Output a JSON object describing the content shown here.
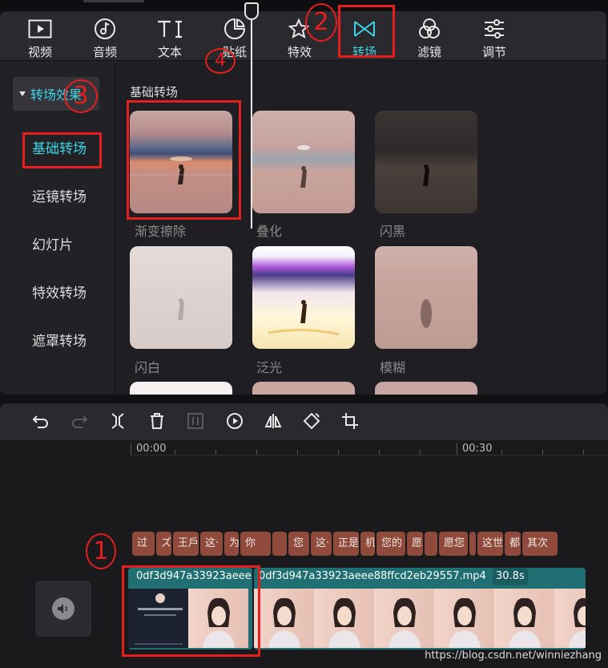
{
  "categories": [
    {
      "label": "视频",
      "icon": "video-icon"
    },
    {
      "label": "音频",
      "icon": "music-icon"
    },
    {
      "label": "文本",
      "icon": "text-icon"
    },
    {
      "label": "贴纸",
      "icon": "sticker-icon"
    },
    {
      "label": "特效",
      "icon": "effects-icon"
    },
    {
      "label": "转场",
      "icon": "transition-icon"
    },
    {
      "label": "滤镜",
      "icon": "filter-icon"
    },
    {
      "label": "调节",
      "icon": "adjust-icon"
    }
  ],
  "active_category": "转场",
  "sidebar": {
    "header": "转场效果",
    "items": [
      "基础转场",
      "运镜转场",
      "幻灯片",
      "特效转场",
      "遮罩转场"
    ],
    "active_item": "基础转场"
  },
  "content": {
    "section_title": "基础转场",
    "tiles": [
      {
        "label": "渐变擦除"
      },
      {
        "label": "叠化"
      },
      {
        "label": "闪黑"
      },
      {
        "label": "闪白"
      },
      {
        "label": "泛光"
      },
      {
        "label": "模糊"
      }
    ]
  },
  "toolbar": {
    "icons": [
      "undo-icon",
      "redo-icon",
      "split-icon",
      "delete-icon",
      "freeze-icon",
      "reverse-play-icon",
      "mirror-icon",
      "rotate-icon",
      "crop-icon"
    ]
  },
  "timeline": {
    "ruler": [
      "00:00",
      "00:30"
    ],
    "subtitles": [
      "过",
      "ズ",
      "王戶",
      "这·",
      "为",
      "你",
      "",
      "您",
      "这·",
      "正是",
      "机",
      "您的",
      "愿",
      "",
      "愿您",
      "",
      "这世",
      "都",
      "其次"
    ],
    "clip1_name": "0df3d947a33923aeee",
    "clip2_name": "0df3d947a33923aeee88ffcd2eb29557.mp4",
    "clip2_duration": "30.8s"
  },
  "annotations": [
    "1",
    "2",
    "3",
    "4"
  ],
  "watermark": "https://blog.csdn.net/winniezhang",
  "colors": {
    "accent": "#3dd3e4",
    "annotation": "#e51e1e",
    "clip": "#1f6f73",
    "subtitle": "#8f4a3c"
  }
}
